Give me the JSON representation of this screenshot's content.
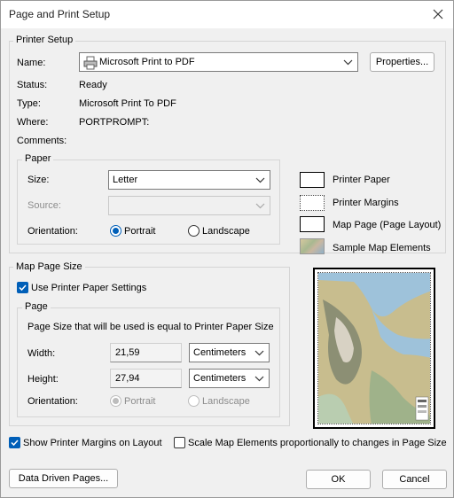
{
  "window": {
    "title": "Page and Print Setup"
  },
  "printer_setup": {
    "legend": "Printer Setup",
    "name_label": "Name:",
    "printer_name": "Microsoft Print to PDF",
    "properties_button": "Properties...",
    "status_label": "Status:",
    "status_value": "Ready",
    "type_label": "Type:",
    "type_value": "Microsoft Print To PDF",
    "where_label": "Where:",
    "where_value": "PORTPROMPT:",
    "comments_label": "Comments:",
    "paper": {
      "legend": "Paper",
      "size_label": "Size:",
      "size_value": "Letter",
      "source_label": "Source:",
      "source_value": "",
      "orientation_label": "Orientation:",
      "portrait": "Portrait",
      "landscape": "Landscape",
      "selected_orientation": "Portrait"
    }
  },
  "preview_legend": {
    "printer_paper": "Printer Paper",
    "printer_margins": "Printer Margins",
    "map_page": "Map Page (Page Layout)",
    "sample_map_elements": "Sample Map Elements"
  },
  "map_page_size": {
    "legend": "Map Page Size",
    "use_printer_paper_settings": "Use Printer Paper Settings",
    "use_printer_paper_checked": true,
    "page": {
      "legend": "Page",
      "info": "Page Size that will be used is equal to Printer Paper Size",
      "width_label": "Width:",
      "width_value": "21,59",
      "width_unit": "Centimeters",
      "height_label": "Height:",
      "height_value": "27,94",
      "height_unit": "Centimeters",
      "orientation_label": "Orientation:",
      "portrait": "Portrait",
      "landscape": "Landscape"
    }
  },
  "options": {
    "show_printer_margins": "Show Printer Margins on Layout",
    "show_printer_margins_checked": true,
    "scale_map_elements": "Scale Map Elements proportionally to changes in Page Size",
    "scale_map_elements_checked": false
  },
  "buttons": {
    "data_driven_pages": "Data Driven Pages...",
    "ok": "OK",
    "cancel": "Cancel"
  },
  "colors": {
    "accent": "#005fb8",
    "background": "#f0f0f0"
  }
}
